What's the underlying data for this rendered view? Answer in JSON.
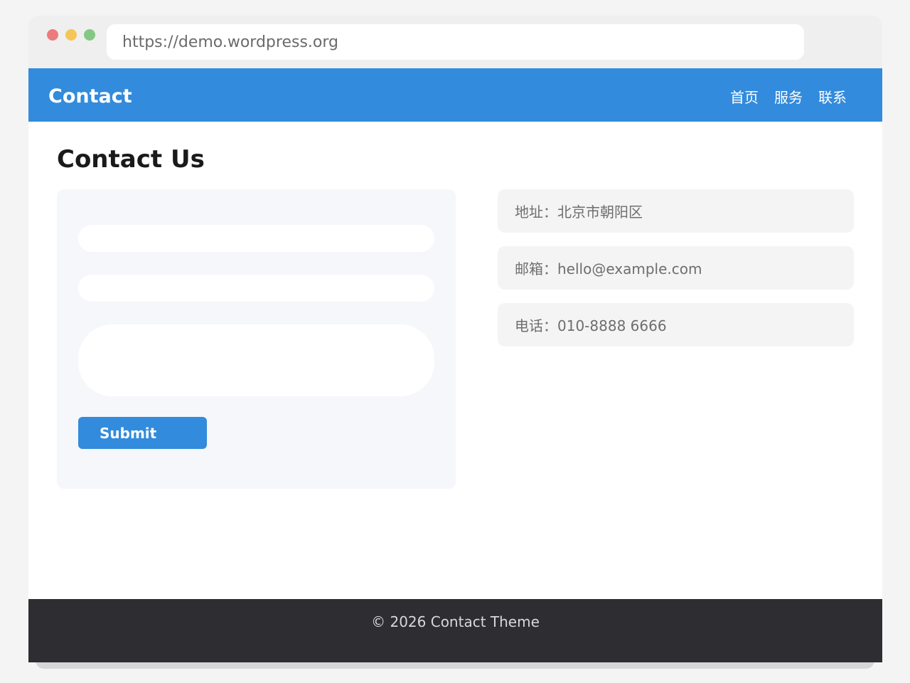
{
  "browser": {
    "url": "https://demo.wordpress.org"
  },
  "navbar": {
    "brand": "Contact",
    "links": [
      "首页",
      "服务",
      "联系"
    ]
  },
  "page": {
    "title": "Contact Us"
  },
  "form": {
    "name_value": "",
    "email_value": "",
    "message_value": "",
    "submit_label": "Submit"
  },
  "info": {
    "address": "地址：北京市朝阳区",
    "email": "邮箱：hello@example.com",
    "phone": "电话：010-8888 6666"
  },
  "footer": {
    "text": "© 2026 Contact Theme"
  },
  "colors": {
    "primary": "#328bdc",
    "footer_bg": "#2e2d32",
    "card_bg": "#f5f7fa"
  }
}
